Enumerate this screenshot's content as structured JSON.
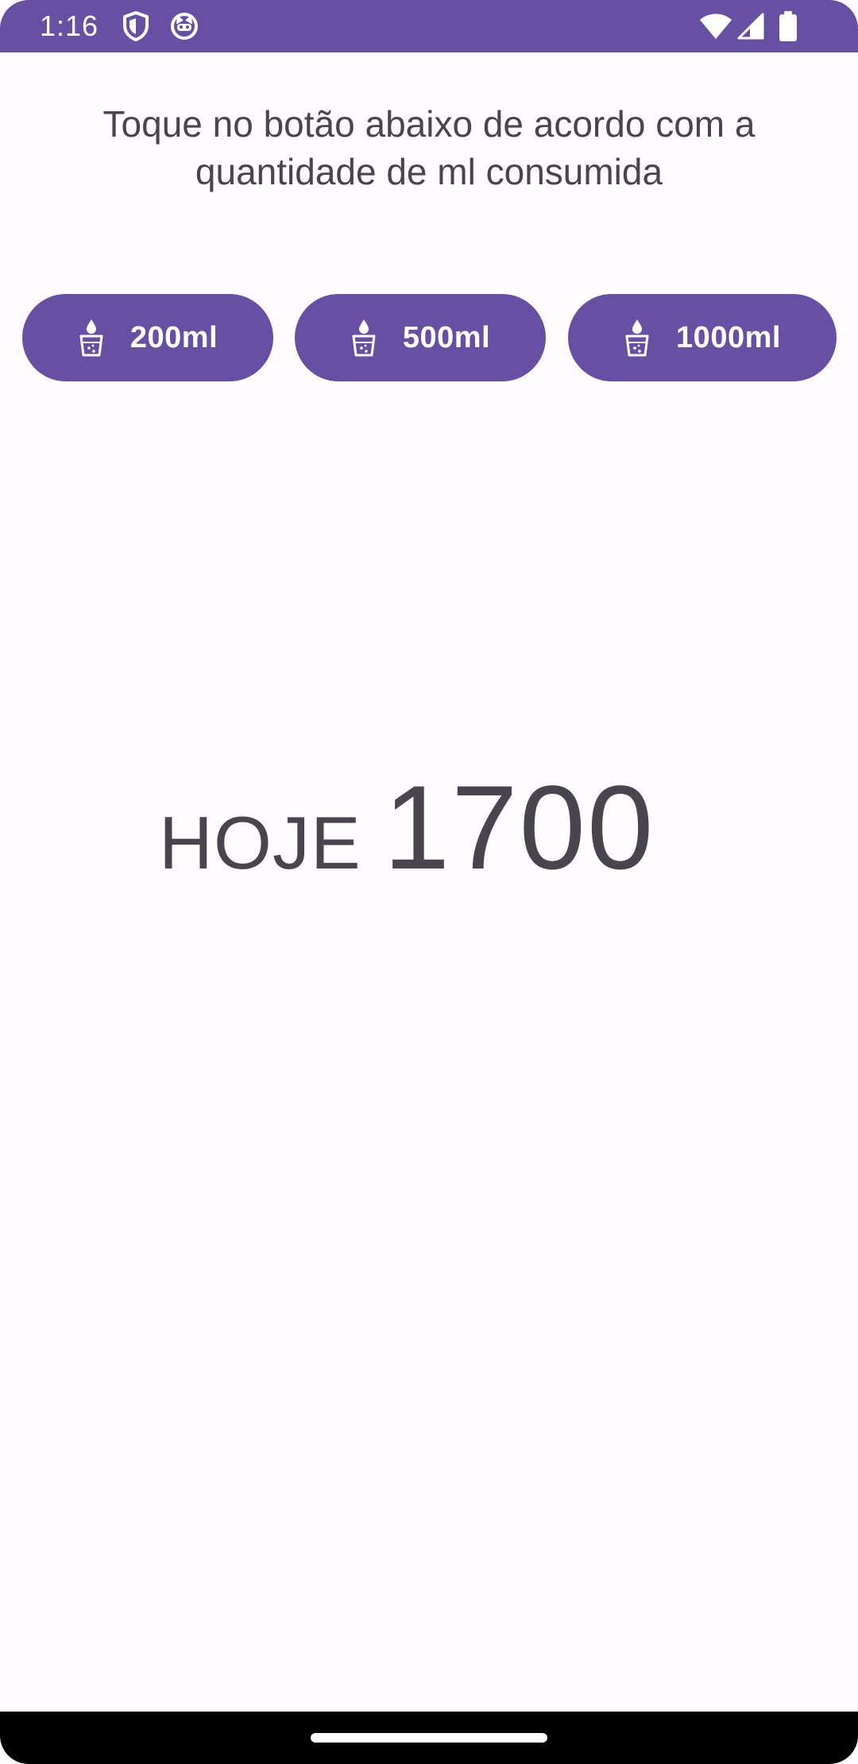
{
  "status_bar": {
    "time": "1:16",
    "left_icons": [
      "shield-icon",
      "cat-face-icon"
    ],
    "right_icons": [
      "wifi-icon",
      "cellular-signal-icon",
      "battery-icon"
    ],
    "color": "#6750a4"
  },
  "main": {
    "instruction": "Toque no botão abaixo de acordo com a quantidade de ml consumida",
    "buttons": [
      {
        "label": "200ml",
        "icon": "water-glass-icon"
      },
      {
        "label": "500ml",
        "icon": "water-glass-icon"
      },
      {
        "label": "1000ml",
        "icon": "water-glass-icon"
      }
    ],
    "today_label": "HOJE",
    "today_value": "1700"
  },
  "colors": {
    "accent": "#6750a4",
    "background": "#fffbfe",
    "text": "#49454f"
  }
}
